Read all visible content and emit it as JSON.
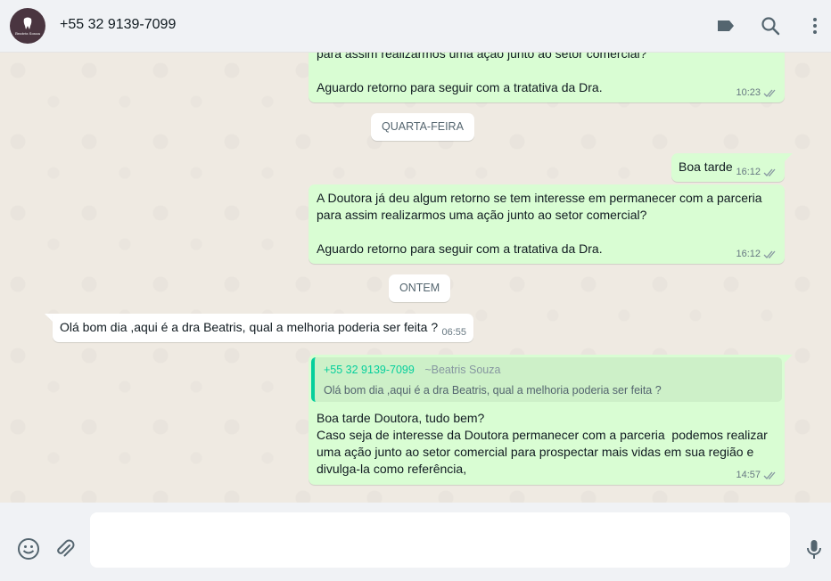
{
  "header": {
    "contact": "+55 32 9139-7099",
    "avatar_text": "Beatris Souza"
  },
  "messages": {
    "m1": {
      "text_top": "para assim realizarmos uma ação junto ao setor comercial?",
      "text_bottom": "Aguardo retorno para seguir com a tratativa da Dra.",
      "time": "10:23"
    },
    "date1": "QUARTA-FEIRA",
    "m2": {
      "text": "Boa tarde",
      "time": "16:12"
    },
    "m3": {
      "text": "A Doutora já deu algum retorno se tem interesse em permanecer com a parceria\npara assim realizarmos uma ação junto ao setor comercial?\n\nAguardo retorno para seguir com a tratativa da Dra.",
      "time": "16:12"
    },
    "date2": "ONTEM",
    "m4": {
      "text": "Olá bom dia ,aqui é a dra Beatris, qual a melhoria poderia ser feita ?",
      "time": "06:55"
    },
    "m5": {
      "quote_name": "+55 32 9139-7099",
      "quote_pushname": "~Beatris Souza",
      "quote_text": "Olá bom dia ,aqui é a dra Beatris, qual a melhoria poderia ser feita ?",
      "text": "Boa tarde Doutora, tudo bem?\nCaso seja de interesse da Doutora permanecer com a parceria  podemos realizar\numa ação junto ao setor comercial para prospectar mais vidas em sua região e\ndivulga-la como referência,",
      "time": "14:57"
    }
  },
  "colors": {
    "outgoing": "#d9fdd3",
    "incoming": "#ffffff",
    "ticks": "#8696a0",
    "quote_accent": "#06cf9c"
  },
  "icons": [
    "label-icon",
    "search-icon",
    "menu-icon",
    "emoji-icon",
    "attach-icon",
    "mic-icon"
  ]
}
